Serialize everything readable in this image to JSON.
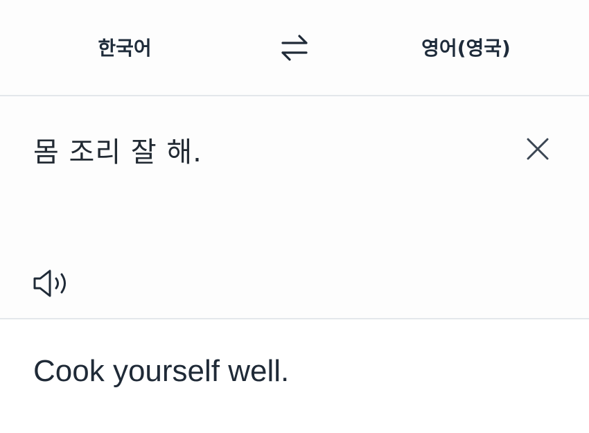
{
  "header": {
    "source_language": "한국어",
    "target_language": "영어(영국)",
    "swap_icon": "swap-arrows-icon"
  },
  "source": {
    "text": "몸 조리 잘 해.",
    "clear_icon": "close-icon",
    "speaker_icon": "speaker-icon"
  },
  "translation": {
    "text": "Cook yourself well."
  },
  "colors": {
    "text": "#1f2a37",
    "divider": "#e3e7eb",
    "background": "#fdfdfd"
  }
}
